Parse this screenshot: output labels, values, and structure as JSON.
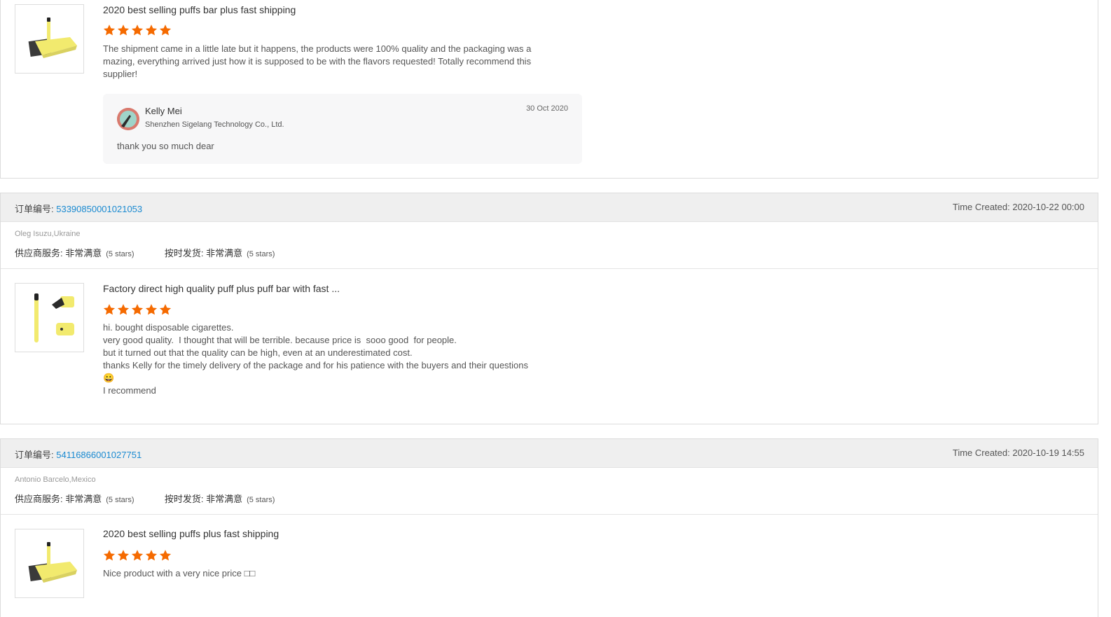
{
  "reviews": [
    {
      "product_title": "2020 best selling puffs bar plus fast shipping",
      "stars": 5,
      "text_lines": [
        "The shipment came in a little late but it happens, the products were 100% quality and the packaging was a",
        "mazing, everything arrived just how it is supposed to be with the flavors requested! Totally recommend this",
        "supplier!"
      ],
      "reply": {
        "name": "Kelly Mei",
        "company": "Shenzhen Sigelang Technology Co., Ltd.",
        "date": "30 Oct 2020",
        "text": "thank you so much dear"
      }
    },
    {
      "order_label": "订单编号: ",
      "order_number": "53390850001021053",
      "time_created": "Time Created: 2020-10-22 00:00",
      "buyer": "Oleg Isuzu,Ukraine",
      "supplier_service_label": "供应商服务: ",
      "supplier_service_value": "非常满意",
      "supplier_service_stars": "(5 stars)",
      "ontime_label": "按时发货: ",
      "ontime_value": "非常满意",
      "ontime_stars": "(5 stars)",
      "product_title": "Factory direct high quality puff plus puff bar with fast ...",
      "stars": 5,
      "text_lines": [
        "hi. bought disposable cigarettes.",
        "very good quality.  I thought that will be terrible. because price is  sooo good  for people.",
        "but it turned out that the quality can be high, even at an underestimated cost.",
        "thanks Kelly for the timely delivery of the package and for his patience with the buyers and their questions",
        "😀",
        "I recommend"
      ]
    },
    {
      "order_label": "订单编号: ",
      "order_number": "54116866001027751",
      "time_created": "Time Created: 2020-10-19 14:55",
      "buyer": "Antonio Barcelo,Mexico",
      "supplier_service_label": "供应商服务: ",
      "supplier_service_value": "非常满意",
      "supplier_service_stars": "(5 stars)",
      "ontime_label": "按时发货: ",
      "ontime_value": "非常满意",
      "ontime_stars": "(5 stars)",
      "product_title": "2020 best selling puffs plus fast shipping",
      "stars": 5,
      "text_lines": [
        "Nice product with a very nice price □□"
      ]
    }
  ],
  "colors": {
    "star": "#f56a00",
    "order_number": "#1a8ad1",
    "header_bg": "#efefef",
    "product_yellow": "#f2ea6e"
  }
}
